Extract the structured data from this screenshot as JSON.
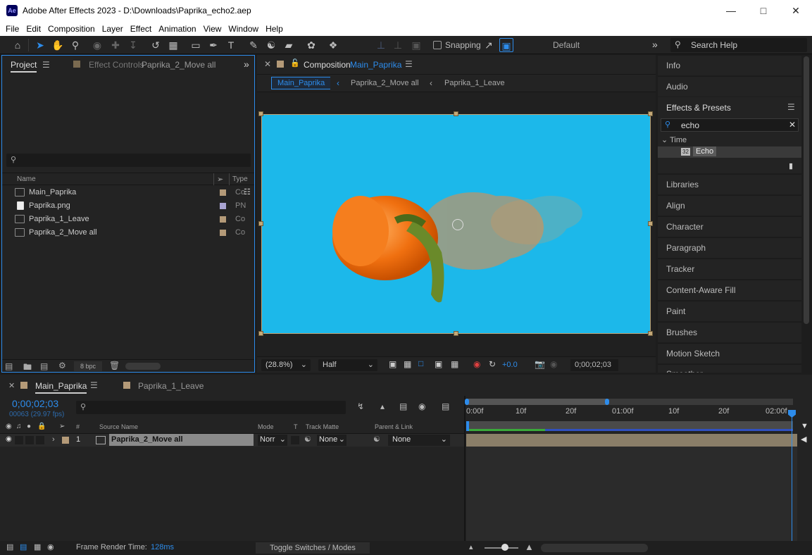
{
  "window": {
    "logo": "Ae",
    "title": "Adobe After Effects 2023 - D:\\Downloads\\Paprika_echo2.aep",
    "min_icon": "minimize-icon",
    "max_icon": "maximize-icon",
    "close_icon": "close-icon"
  },
  "menu": [
    "File",
    "Edit",
    "Composition",
    "Layer",
    "Effect",
    "Animation",
    "View",
    "Window",
    "Help"
  ],
  "toolbar": {
    "snapping_label": "Snapping",
    "workspace": "Default",
    "search_help": "Search Help"
  },
  "project": {
    "tab_label": "Project",
    "effect_controls_label": "Effect Controls",
    "effect_controls_target": "Paprika_2_Move all",
    "search_placeholder": "",
    "col_name": "Name",
    "col_type": "Type",
    "items": [
      {
        "name": "Main_Paprika",
        "type": "Co",
        "swatch": "#b49a78",
        "kind": "composition"
      },
      {
        "name": "Paprika.png",
        "type": "PN",
        "swatch": "#a9a4d2",
        "kind": "image"
      },
      {
        "name": "Paprika_1_Leave",
        "type": "Co",
        "swatch": "#b49a78",
        "kind": "composition"
      },
      {
        "name": "Paprika_2_Move all",
        "type": "Co",
        "swatch": "#b49a78",
        "kind": "composition"
      }
    ],
    "bpc": "8 bpc"
  },
  "composition": {
    "tab_prefix": "Composition",
    "tab_name": "Main_Paprika",
    "breadcrumbs": [
      "Main_Paprika",
      "Paprika_2_Move all",
      "Paprika_1_Leave"
    ],
    "bg_color": "#1cb8ea",
    "zoom": "(28.8%)",
    "resolution": "Half",
    "exposure": "+0.0",
    "timecode": "0;00;02;03"
  },
  "right_panel": {
    "info": "Info",
    "audio": "Audio",
    "effects_presets": "Effects & Presets",
    "search_value": "echo",
    "category": "Time",
    "effect_item": "Echo",
    "effect_badge": "32",
    "panels": [
      "Libraries",
      "Align",
      "Character",
      "Paragraph",
      "Tracker",
      "Content-Aware Fill",
      "Paint",
      "Brushes",
      "Motion Sketch",
      "Smoother"
    ]
  },
  "timeline": {
    "tabs": [
      "Main_Paprika",
      "Paprika_1_Leave"
    ],
    "timecode": "0;00;02;03",
    "frame_info": "00063 (29.97 fps)",
    "col_source": "Source Name",
    "col_mode": "Mode",
    "col_t": "T",
    "col_track_matte": "Track Matte",
    "col_parent": "Parent & Link",
    "col_num": "#",
    "layer": {
      "index": "1",
      "name": "Paprika_2_Move all",
      "mode": "Norr",
      "matte": "None",
      "parent": "None"
    },
    "ruler": [
      "0:00f",
      "10f",
      "20f",
      "01:00f",
      "10f",
      "20f",
      "02:00f"
    ],
    "frame_render_label": "Frame Render Time:",
    "frame_render_value": "128ms",
    "toggle_label": "Toggle Switches / Modes"
  }
}
